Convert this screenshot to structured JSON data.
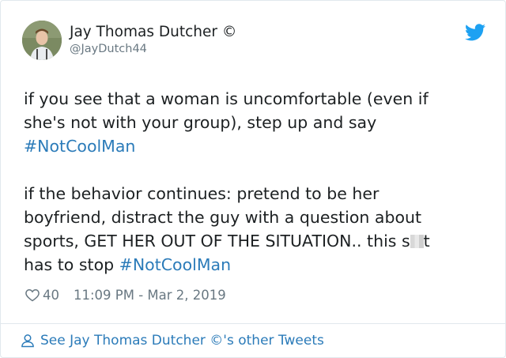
{
  "author": {
    "name": "Jay Thomas Dutcher ©",
    "handle": "@JayDutch44",
    "avatar": "user-avatar-photo"
  },
  "tweet": {
    "para1": {
      "line1": "if you see that a woman is uncomfortable (even if",
      "line2": "she's not with your group), step up and say",
      "hashtag": "#NotCoolMan"
    },
    "para2": {
      "line1": "if the behavior continues: pretend to be her",
      "line2": "boyfriend, distract the guy with a question about",
      "line3_before_censor": "sports, GET HER OUT OF THE SITUATION.. this s",
      "line3_after_censor": "t",
      "line4": "has to stop ",
      "hashtag": "#NotCoolMan"
    }
  },
  "meta": {
    "like_icon": "heart-icon",
    "likes": "40",
    "timestamp": "11:09 PM - Mar 2, 2019"
  },
  "footer": {
    "icon": "person-icon",
    "link_text": "See Jay Thomas Dutcher ©'s other Tweets"
  },
  "colors": {
    "link": "#2b7bb9",
    "twitter_blue": "#1da1f2",
    "secondary_text": "#697882",
    "border": "#e1e8ed"
  }
}
